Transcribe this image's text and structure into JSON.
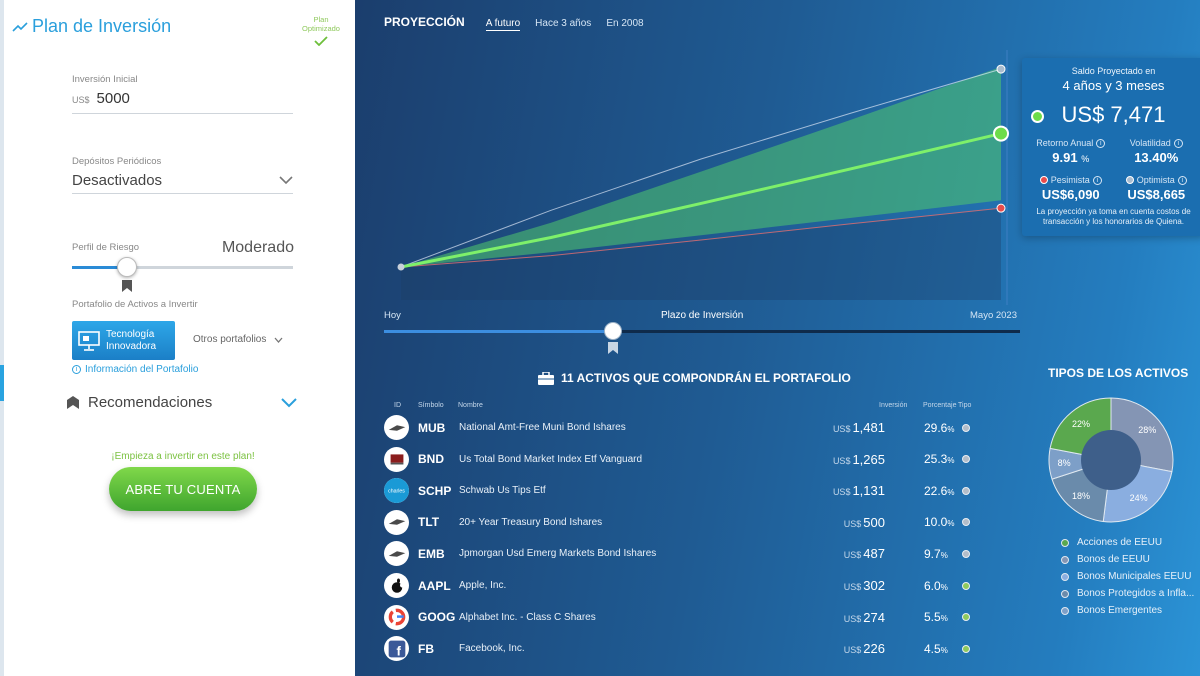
{
  "left": {
    "title": "Plan de Inversión",
    "plan_badge": "Plan Optimizado",
    "initial_label": "Inversión Inicial",
    "initial_currency": "US$",
    "initial_value": "5000",
    "deposits_label": "Depósitos Periódicos",
    "deposits_value": "Desactivados",
    "risk_label": "Perfil de Riesgo",
    "risk_value": "Moderado",
    "risk_level": 0.25,
    "portfolio_label": "Portafolio de Activos a Invertir",
    "portfolio_selected": "Tecnología Innovadora",
    "other_portfolios": "Otros portafolios",
    "portfolio_info": "Información del Portafolio",
    "recommendations": "Recomendaciones",
    "start_text": "¡Empieza a invertir en este plan!",
    "open_account": "ABRE TU CUENTA"
  },
  "projection": {
    "title": "PROYECCIÓN",
    "tabs": [
      "A futuro",
      "Hace 3 años",
      "En 2008"
    ],
    "active_tab": 0,
    "axis_start": "Hoy",
    "axis_title": "Plazo de Inversión",
    "axis_end": "Mayo 2023",
    "time_progress": 0.36
  },
  "chart_data": {
    "type": "area",
    "x": [
      0,
      0.25,
      0.5,
      0.75,
      1
    ],
    "series": [
      {
        "values": [
          5000,
          5546,
          6177,
          6818,
          7471
        ]
      },
      {
        "values": [
          5000,
          5210,
          5500,
          5800,
          6090
        ]
      },
      {
        "values": [
          5000,
          6050,
          7000,
          7850,
          8665
        ]
      }
    ],
    "xlabel": "Plazo de Inversión",
    "x_tick_labels": [
      "Hoy",
      "Mayo 2023"
    ]
  },
  "tooltip": {
    "line1": "Saldo Proyectado en",
    "line2": "4 años y 3 meses",
    "amount": "US$ 7,471",
    "return_label": "Retorno Anual",
    "return_value": "9.91",
    "return_unit": "%",
    "vol_label": "Volatilidad",
    "vol_value": "13.40%",
    "pess_label": "Pesimista",
    "pess_value": "US$6,090",
    "opt_label": "Optimista",
    "opt_value": "US$8,665",
    "footnote": "La proyección ya toma en cuenta costos de transacción y los honorarios de Quiena."
  },
  "assets": {
    "title": "11 ACTIVOS QUE COMPONDRÁN EL PORTAFOLIO",
    "headers": {
      "id": "ID",
      "symbol": "Símbolo",
      "name": "Nombre",
      "investment": "Inversión",
      "percent": "Porcentaje",
      "type": "Tipo"
    },
    "currency": "US$",
    "pct_unit": "%",
    "rows": [
      {
        "symbol": "MUB",
        "name": "National Amt-Free Muni Bond Ishares",
        "investment": "1,481",
        "percent": "29.6",
        "type_color": "#b3bdc9"
      },
      {
        "symbol": "BND",
        "name": "Us Total Bond Market Index Etf Vanguard",
        "investment": "1,265",
        "percent": "25.3",
        "type_color": "#b3bdc9"
      },
      {
        "symbol": "SCHP",
        "name": "Schwab Us Tips Etf",
        "investment": "1,131",
        "percent": "22.6",
        "type_color": "#b3bdc9"
      },
      {
        "symbol": "TLT",
        "name": "20+ Year Treasury Bond Ishares",
        "investment": "500",
        "percent": "10.0",
        "type_color": "#b3bdc9"
      },
      {
        "symbol": "EMB",
        "name": "Jpmorgan Usd Emerg Markets Bond Ishares",
        "investment": "487",
        "percent": "9.7",
        "type_color": "#b3bdc9"
      },
      {
        "symbol": "AAPL",
        "name": "Apple, Inc.",
        "investment": "302",
        "percent": "6.0",
        "type_color": "#8fc95d"
      },
      {
        "symbol": "GOOG",
        "name": "Alphabet Inc. - Class C Shares",
        "investment": "274",
        "percent": "5.5",
        "type_color": "#8fc95d"
      },
      {
        "symbol": "FB",
        "name": "Facebook, Inc.",
        "investment": "226",
        "percent": "4.5",
        "type_color": "#8fc95d"
      }
    ]
  },
  "asset_types": {
    "title": "TIPOS DE LOS ACTIVOS",
    "slices": [
      {
        "label": "Acciones de EEUU",
        "percent": 22,
        "color": "#5aa84e"
      },
      {
        "label": "Bonos de EEUU",
        "percent": 28,
        "color": "#8495b4"
      },
      {
        "label": "Bonos Municipales EEUU",
        "percent": 24,
        "color": "#8aaee0"
      },
      {
        "label": "Bonos Protegidos a Infla...",
        "percent": 18,
        "color": "#6a8bab"
      },
      {
        "label": "Bonos Emergentes",
        "percent": 8,
        "color": "#7d9fc8"
      }
    ]
  }
}
